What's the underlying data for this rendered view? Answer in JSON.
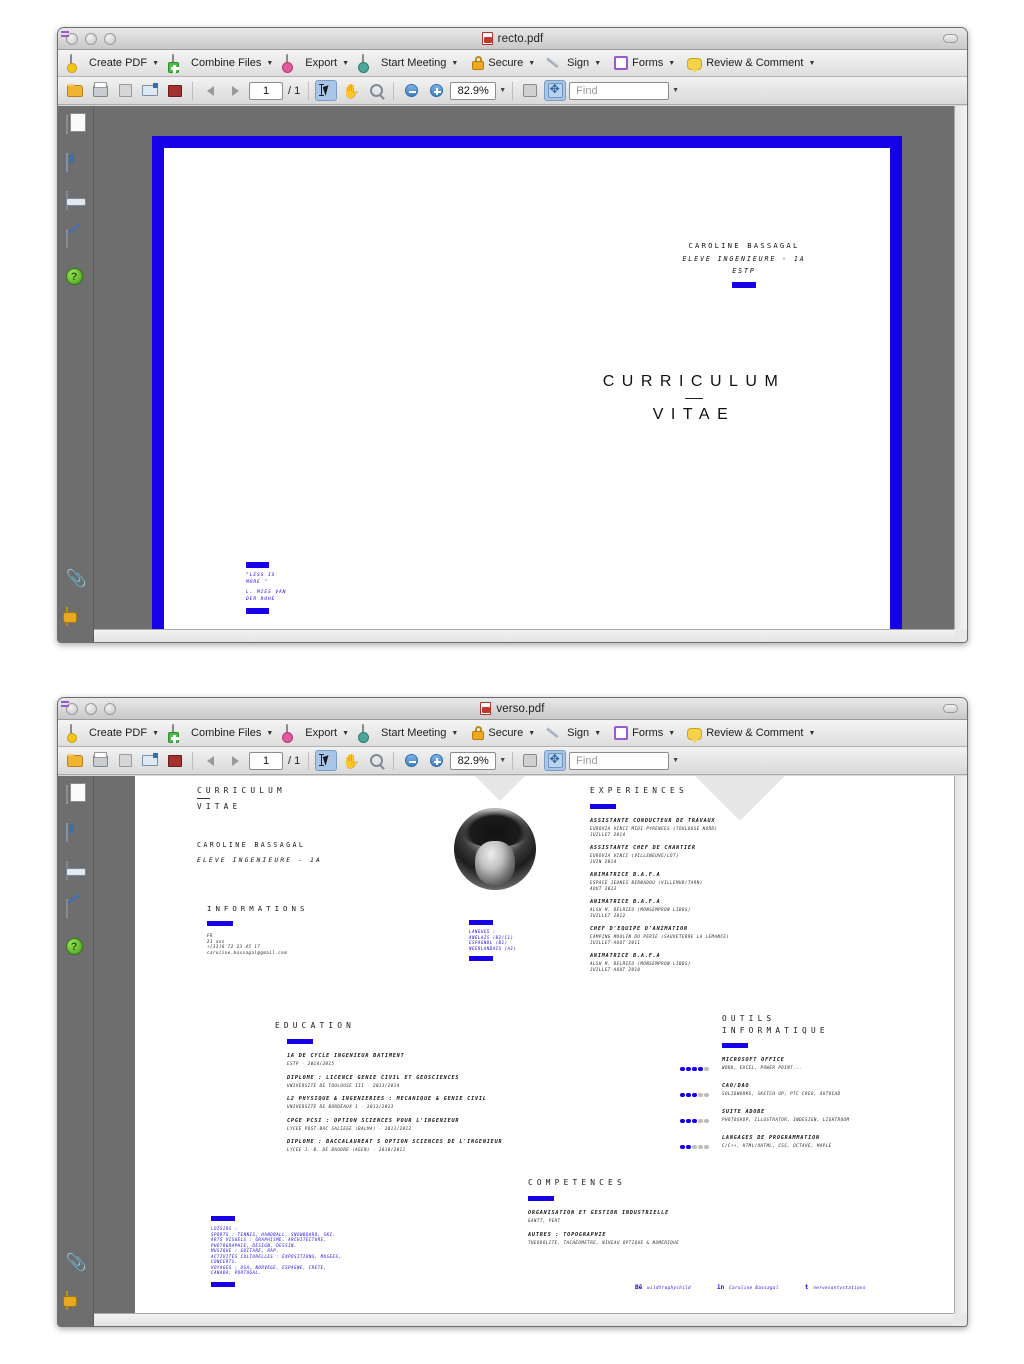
{
  "windows": [
    {
      "title": "recto.pdf",
      "toolbar": {
        "items": [
          {
            "label": "Create PDF",
            "icon": "create-pdf-icon"
          },
          {
            "label": "Combine Files",
            "icon": "combine-files-icon"
          },
          {
            "label": "Export",
            "icon": "export-icon"
          },
          {
            "label": "Start Meeting",
            "icon": "start-meeting-icon"
          },
          {
            "label": "Secure",
            "icon": "lock-icon"
          },
          {
            "label": "Sign",
            "icon": "pen-icon"
          },
          {
            "label": "Forms",
            "icon": "forms-icon"
          },
          {
            "label": "Review & Comment",
            "icon": "comment-bubble-icon"
          }
        ]
      },
      "toolbar2": {
        "page_value": "1",
        "page_total": "/ 1",
        "zoom_value": "82.9%",
        "find_placeholder": "Find"
      }
    },
    {
      "title": "verso.pdf",
      "toolbar": {
        "items": [
          {
            "label": "Create PDF",
            "icon": "create-pdf-icon"
          },
          {
            "label": "Combine Files",
            "icon": "combine-files-icon"
          },
          {
            "label": "Export",
            "icon": "export-icon"
          },
          {
            "label": "Start Meeting",
            "icon": "start-meeting-icon"
          },
          {
            "label": "Secure",
            "icon": "lock-icon"
          },
          {
            "label": "Sign",
            "icon": "pen-icon"
          },
          {
            "label": "Forms",
            "icon": "forms-icon"
          },
          {
            "label": "Review & Comment",
            "icon": "comment-bubble-icon"
          }
        ]
      },
      "toolbar2": {
        "page_value": "1",
        "page_total": "/ 1",
        "zoom_value": "82.9%",
        "find_placeholder": "Find"
      }
    }
  ],
  "colors": {
    "accent_blue": "#1500e8",
    "band_grey": "#e6e6e6",
    "chrome_grey": "#6e6e6e"
  },
  "recto": {
    "name": "CAROLINE BASSAGAL",
    "subtitle": "ELEVE INGENIEURE - 1A",
    "school": "ESTP",
    "title_line1": "CURRICULUM",
    "title_line2": "VITAE",
    "quote_lines": [
      "\"LESS IS",
      "MORE \"",
      "L. MIES VAN",
      "DER ROHE"
    ]
  },
  "verso": {
    "header": {
      "title_line1": "CURRICULUM",
      "title_line2": "VITAE",
      "name": "CAROLINE BASSAGAL",
      "subtitle": "ELEVE INGENIEURE - 1A"
    },
    "informations": {
      "heading": "INFORMATIONS",
      "lines": [
        "FR",
        "21 ans",
        "+[33]6 72 23 45 17",
        "caroline.bassagal@gmail.com"
      ]
    },
    "langues": {
      "heading": "LANGUES :",
      "items": [
        "ANGLAIS (B2/C1)",
        "ESPAGNOL (B1)",
        "NEERLANDAIS (A1)"
      ]
    },
    "experiences": {
      "heading": "EXPERIENCES",
      "items": [
        {
          "role": "ASSISTANTE CONDUCTEUR DE TRAVAUX",
          "org": "EUROVIA VINCI MIDI-PYRENEES (TOULOUSE NORD)",
          "date": "JUILLET 2014"
        },
        {
          "role": "ASSISTANTE CHEF DE CHANTIER",
          "org": "EUROVIA VINCI (VILLENEUVE/LOT)",
          "date": "JUIN 2014"
        },
        {
          "role": "ANIMATRICE B.A.F.A",
          "org": "ESPACE JEUNES BERNADOU (VILLEMUR/TARN)",
          "date": "AOUT 2013"
        },
        {
          "role": "ANIMATRICE B.A.F.A",
          "org": "ALSH M. DELRIEU (MONSEMPRON LIBOS)",
          "date": "JUILLET 2012"
        },
        {
          "role": "CHEF D'EQUIPE D'ANIMATION",
          "org": "CAMPING MOULIN DU PERIE (SAUVETERRE LA LEMANCE)",
          "date": "JUILLET-AOUT 2011"
        },
        {
          "role": "ANIMATRICE B.A.F.A",
          "org": "ALSH M. DELRIEU (MONSEMPRON LIBOS)",
          "date": "JUILLET-AOUT 2010"
        }
      ]
    },
    "education": {
      "heading": "EDUCATION",
      "items": [
        {
          "degree": "1A DE CYCLE INGENIEUR BATIMENT",
          "school": "ESTP - 2014/2015"
        },
        {
          "degree": "DIPLOME : LICENCE GENIE CIVIL ET GEOSCIENCES",
          "school": "UNIVERSITE DE TOULOUSE III - 2013/2014"
        },
        {
          "degree": "L2 PHYSIQUE & INGENIERIES : MECANIQUE & GENIE CIVIL",
          "school": "UNIVERSITE DE BORDEAUX 1 - 2012/2013"
        },
        {
          "degree": "CPGE PCSI : OPTION SCIENCES POUR L'INGENIEUR",
          "school": "LYCEE POST-BAC SALIEGE (BALMA) - 2011/2012"
        },
        {
          "degree": "DIPLOME : BACCALAUREAT S OPTION SCIENCES DE L'INGENIEUR",
          "school": "LYCEE J.-B. DE BAUDRE (AGEN) - 2010/2011"
        }
      ]
    },
    "outils": {
      "heading_line1": "OUTILS",
      "heading_line2": "INFORMATIQUE",
      "items": [
        {
          "name": "MICROSOFT OFFICE",
          "detail": "WORD, EXCEL, POWER POINT...",
          "level": 4,
          "max": 5
        },
        {
          "name": "CAO/DAO",
          "detail": "SOLIDWORKS, SKETCH UP, PTC CREO, AUTOCAD",
          "level": 3,
          "max": 5
        },
        {
          "name": "SUITE ADOBE",
          "detail": "PHOTOSHOP, ILLUSTRATOR, INDESIGN, LIGHTROOM",
          "level": 3,
          "max": 5
        },
        {
          "name": "LANGAGES DE PROGRAMMATION",
          "detail": "C/C++, HTML/XHTML, CSS, OCTAVE, MAPLE",
          "level": 2,
          "max": 5
        }
      ]
    },
    "competences": {
      "heading": "COMPETENCES",
      "items": [
        {
          "name": "ORGANISATION ET GESTION INDUSTRIELLE",
          "detail": "GANTT, PERT"
        },
        {
          "name": "AUTRES : TOPOGRAPHIE",
          "detail": "THEODOLITE, TACHEOMETRE, NIVEAU OPTIQUE & NUMERIQUE"
        }
      ]
    },
    "loisirs": {
      "heading": "LOISIRS :",
      "lines": [
        "SPORTS : TENNIS, HANDBALL, SNOWBOARD, SKI.",
        "ARTS VISUELS : GRAPHISME, ARCHITECTURE,",
        "PHOTOGRAPHIE, DESIGN, DESSIN.",
        "MUSIQUE : GUITARE, RAP.",
        "ACTIVITES CULTURELLES : EXPOSITIONS, MUSEES,",
        "CONCERTS.",
        "VOYAGES : USA, NORVEGE, ESPAGNE, CRETE,",
        "CANADA, PORTUGAL."
      ]
    },
    "social": [
      {
        "icon": "behance-icon",
        "glyph": "Bē",
        "handle": "wildtrophychild"
      },
      {
        "icon": "linkedin-icon",
        "glyph": "in",
        "handle": "Caroline Bassagal"
      },
      {
        "icon": "tumblr-icon",
        "glyph": "t",
        "handle": "nervesontvstations"
      }
    ]
  }
}
